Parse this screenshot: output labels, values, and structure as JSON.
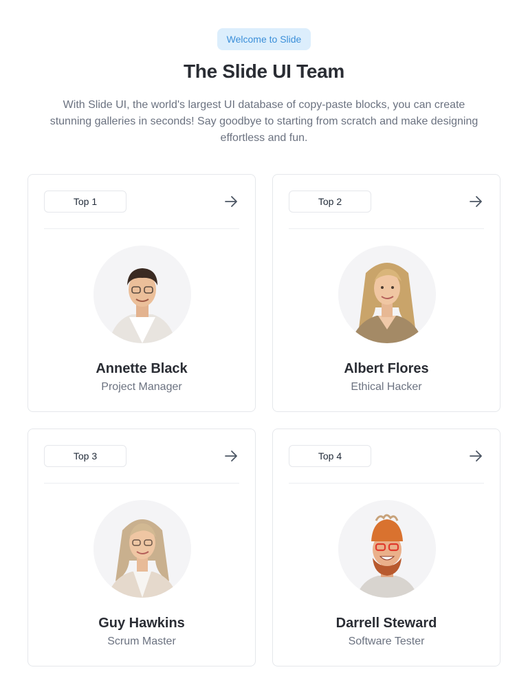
{
  "header": {
    "badge": "Welcome to Slide",
    "title": "The Slide UI Team",
    "description": "With Slide UI, the world's largest UI database of copy-paste blocks, you can create stunning galleries in seconds! Say goodbye to starting from scratch and make designing effortless and fun."
  },
  "members": [
    {
      "rank": "Top 1",
      "name": "Annette Black",
      "role": "Project Manager"
    },
    {
      "rank": "Top 2",
      "name": "Albert Flores",
      "role": "Ethical Hacker"
    },
    {
      "rank": "Top 3",
      "name": "Guy Hawkins",
      "role": "Scrum Master"
    },
    {
      "rank": "Top 4",
      "name": "Darrell Steward",
      "role": "Software Tester"
    }
  ],
  "icons": {
    "arrow": "arrow-right-icon"
  },
  "colors": {
    "badge_bg": "#dceefc",
    "badge_text": "#3b8fd9",
    "title": "#2a2d34",
    "muted": "#6b7280",
    "border": "#e5e7eb"
  }
}
